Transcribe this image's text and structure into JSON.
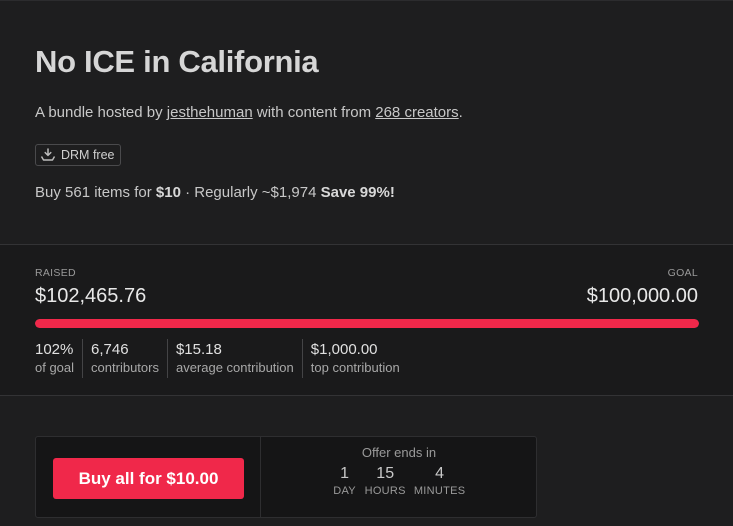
{
  "bundle": {
    "title": "No ICE in California",
    "byline_prefix": "A bundle hosted by",
    "host": "jesthehuman",
    "byline_middle": "with content from",
    "creators_link": "268 creators",
    "byline_suffix": ".",
    "badge": {
      "icon": "download-icon",
      "label": "DRM free"
    },
    "offer": {
      "prefix": "Buy 561 items for",
      "price": "$10",
      "regular": "· Regularly ~$1,974",
      "save": "Save 99%!"
    }
  },
  "funding": {
    "raised_label": "RAISED",
    "raised_value": "$102,465.76",
    "goal_label": "GOAL",
    "goal_value": "$100,000.00",
    "progress_fraction": 1.0,
    "metrics": [
      {
        "value": "102%",
        "caption": "of goal"
      },
      {
        "value": "6,746",
        "caption": "contributors"
      },
      {
        "value": "$15.18",
        "caption": "average contribution"
      },
      {
        "value": "$1,000.00",
        "caption": "top contribution"
      }
    ]
  },
  "purchase": {
    "button_label": "Buy all for $10.00",
    "timer_title": "Offer ends in",
    "countdown": [
      {
        "value": "1",
        "unit": "DAY"
      },
      {
        "value": "15",
        "unit": "HOURS"
      },
      {
        "value": "4",
        "unit": "MINUTES"
      }
    ]
  },
  "colors": {
    "accent": "#f0284a",
    "background": "#1e1e1f",
    "stats_background": "#1a1a1b"
  }
}
